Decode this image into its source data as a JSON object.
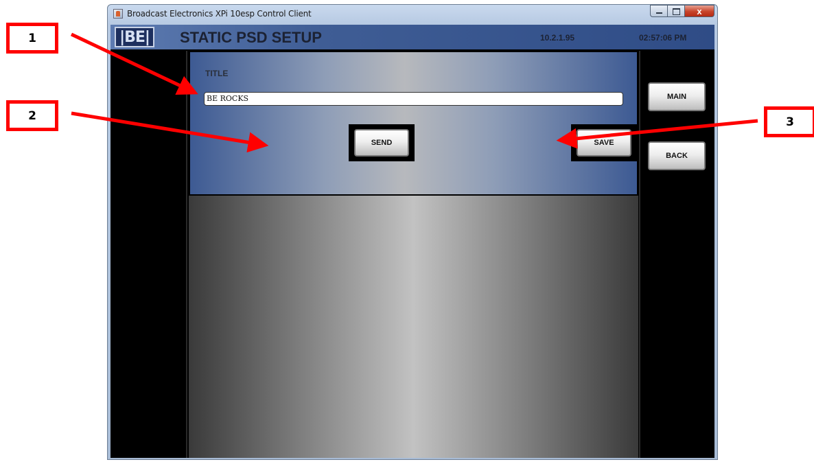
{
  "window": {
    "title": "Broadcast Electronics XPi 10esp Control Client",
    "close_glyph": "x"
  },
  "header": {
    "logo_text": "|BE|",
    "page_title": "STATIC PSD SETUP",
    "ip_address": "10.2.1.95",
    "clock": "02:57:06 PM"
  },
  "form": {
    "field_label": "TITLE",
    "title_value": "BE ROCKS",
    "send_label": "SEND",
    "save_label": "SAVE"
  },
  "nav": {
    "main_label": "MAIN",
    "back_label": "BACK"
  },
  "annotations": [
    "1",
    "2",
    "3"
  ],
  "colors": {
    "annotation": "#ff0000",
    "header_blue": "#3f5d95",
    "panel_blue": "#3d5a93"
  },
  "icons": {
    "app": "java-app-icon",
    "minimize": "minimize-icon",
    "maximize": "maximize-icon",
    "close": "close-icon"
  }
}
